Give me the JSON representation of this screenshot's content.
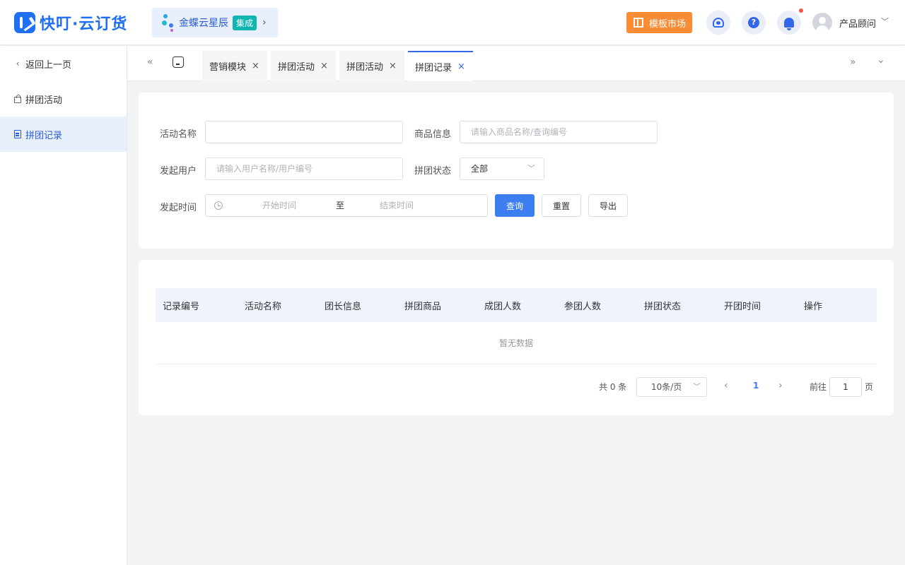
{
  "header": {
    "logo_text": "快叮·云订货",
    "kingdee": {
      "name": "金蝶云星辰",
      "badge": "集成",
      "arrow": "›"
    },
    "market_button": "模板市场",
    "help_glyph": "?",
    "user_name": "产品顾问"
  },
  "sidebar": {
    "back": "返回上一页",
    "items": [
      {
        "label": "拼团活动",
        "active": false
      },
      {
        "label": "拼团记录",
        "active": true
      }
    ]
  },
  "tabs": {
    "prev_nav": "«",
    "next_nav": "»",
    "dropdown": "⌄",
    "items": [
      {
        "label": "营销模块",
        "close": "×"
      },
      {
        "label": "拼团活动",
        "close": "×"
      },
      {
        "label": "拼团活动",
        "close": "×"
      },
      {
        "label": "拼团记录",
        "close": "×",
        "active": true
      }
    ]
  },
  "filters": {
    "activity_name": {
      "label": "活动名称",
      "value": "",
      "placeholder": ""
    },
    "product_info": {
      "label": "商品信息",
      "placeholder": "请输入商品名称/查询编号"
    },
    "initiator": {
      "label": "发起用户",
      "placeholder": "请输入用户名称/用户编号"
    },
    "status": {
      "label": "拼团状态",
      "value": "全部"
    },
    "time": {
      "label": "发起时间",
      "start_placeholder": "开始时间",
      "separator": "至",
      "end_placeholder": "结束时间"
    },
    "buttons": {
      "query": "查询",
      "reset": "重置",
      "export": "导出"
    }
  },
  "table": {
    "columns": [
      "记录编号",
      "活动名称",
      "团长信息",
      "拼团商品",
      "成团人数",
      "参团人数",
      "拼团状态",
      "开团时间",
      "操作"
    ],
    "rows": [],
    "empty_text": "暂无数据"
  },
  "pagination": {
    "total": "共 0 条",
    "page_size": "10条/页",
    "current_page": "1",
    "goto_label": "前往",
    "goto_value": "1",
    "goto_unit": "页"
  },
  "colors": {
    "primary": "#3c7df0",
    "brand": "#1e6ff1",
    "market": "#fa8c35",
    "badge": "#10b5b1",
    "notification_dot": "#f5544d"
  }
}
